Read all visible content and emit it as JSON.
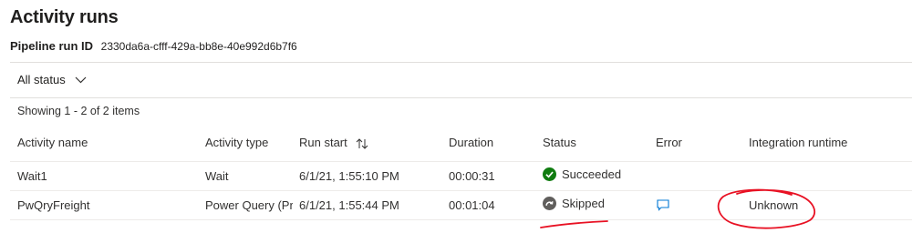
{
  "header": {
    "title": "Activity runs",
    "run_id_label": "Pipeline run ID",
    "run_id_value": "2330da6a-cfff-429a-bb8e-40e992d6b7f6"
  },
  "filter": {
    "selected": "All status",
    "icon": "chevron-down-icon"
  },
  "summary": "Showing 1 - 2 of 2 items",
  "table": {
    "columns": [
      "Activity name",
      "Activity type",
      "Run start",
      "Duration",
      "Status",
      "Error",
      "Integration runtime"
    ],
    "sort_icon": "sort-arrows-icon",
    "rows": [
      {
        "activity_name": "Wait1",
        "activity_type": "Wait",
        "run_start": "6/1/21, 1:55:10 PM",
        "duration": "00:00:31",
        "status": "Succeeded",
        "status_icon": "success-check-icon",
        "error": "",
        "integration_runtime": ""
      },
      {
        "activity_name": "PwQryFreight",
        "activity_type": "Power Query (Pr",
        "run_start": "6/1/21, 1:55:44 PM",
        "duration": "00:01:04",
        "status": "Skipped",
        "status_icon": "skipped-icon",
        "error": "",
        "error_icon": "message-bubble-icon",
        "integration_runtime": "Unknown"
      }
    ]
  },
  "colors": {
    "success": "#107c10",
    "skipped": "#605e5c",
    "link": "#0078d4",
    "annotation": "#e81123"
  }
}
